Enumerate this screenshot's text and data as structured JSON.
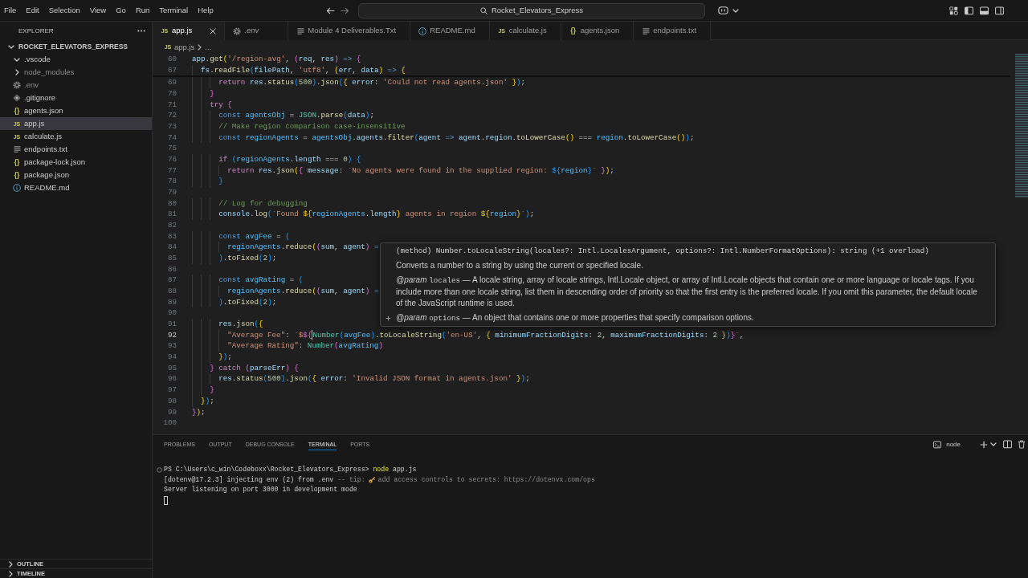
{
  "title_bar": {
    "menu": [
      "File",
      "Edit",
      "Selection",
      "View",
      "Go",
      "Run",
      "Terminal",
      "Help"
    ],
    "command_center": "Rocket_Elevators_Express"
  },
  "sidebar": {
    "title": "EXPLORER",
    "root": {
      "label": "ROCKET_ELEVATORS_EXPRESS",
      "expanded": true,
      "children": [
        {
          "label": ".vscode",
          "kind": "folder",
          "expanded": true,
          "selected": false,
          "ignored": false
        },
        {
          "label": "node_modules",
          "kind": "folder",
          "expanded": false,
          "selected": false,
          "ignored": true
        },
        {
          "label": ".env",
          "kind": "env",
          "selected": false,
          "ignored": true
        },
        {
          "label": ".gitignore",
          "kind": "gitignore",
          "selected": false,
          "ignored": false
        },
        {
          "label": "agents.json",
          "kind": "json",
          "glyph": "{}",
          "selected": false,
          "ignored": false
        },
        {
          "label": "app.js",
          "kind": "js",
          "glyph": "JS",
          "selected": true,
          "ignored": false
        },
        {
          "label": "calculate.js",
          "kind": "js",
          "glyph": "JS",
          "selected": false,
          "ignored": false
        },
        {
          "label": "endpoints.txt",
          "kind": "text",
          "selected": false,
          "ignored": false
        },
        {
          "label": "package-lock.json",
          "kind": "json",
          "glyph": "{}",
          "selected": false,
          "ignored": false
        },
        {
          "label": "package.json",
          "kind": "json",
          "glyph": "{}",
          "selected": false,
          "ignored": false
        },
        {
          "label": "README.md",
          "kind": "info",
          "selected": false,
          "ignored": false
        }
      ]
    },
    "sections": [
      {
        "label": "OUTLINE",
        "expanded": false
      },
      {
        "label": "TIMELINE",
        "expanded": false
      }
    ]
  },
  "tabs": [
    {
      "label": "app.js",
      "kind": "js",
      "glyph": "JS",
      "selected": true,
      "preview": false
    },
    {
      "label": ".env",
      "kind": "env",
      "selected": false,
      "preview": true
    },
    {
      "label": "Module 4 Deliverables.Txt",
      "kind": "text",
      "selected": false,
      "preview": false
    },
    {
      "label": "README.md",
      "kind": "info",
      "selected": false,
      "preview": false
    },
    {
      "label": "calculate.js",
      "kind": "js",
      "glyph": "JS",
      "selected": false,
      "preview": false
    },
    {
      "label": "agents.json",
      "kind": "json",
      "glyph": "{}",
      "selected": false,
      "preview": false
    },
    {
      "label": "endpoints.txt",
      "kind": "text",
      "selected": false,
      "preview": false
    }
  ],
  "breadcrumb": [
    {
      "label": "app.js",
      "kind": "js",
      "glyph": "JS"
    },
    {
      "label": "..."
    }
  ],
  "editor": {
    "sticky_lines": [
      {
        "number": "60",
        "tokens": [
          {
            "kind": "variable",
            "text": "app"
          },
          {
            "kind": "plain",
            "text": "."
          },
          {
            "kind": "function",
            "text": "get"
          },
          {
            "kind": "bracket1",
            "text": "("
          },
          {
            "kind": "string",
            "text": "'/region-avg'"
          },
          {
            "kind": "plain",
            "text": ", "
          },
          {
            "kind": "bracket2",
            "text": "("
          },
          {
            "kind": "variable",
            "text": "req"
          },
          {
            "kind": "plain",
            "text": ", "
          },
          {
            "kind": "variable",
            "text": "res"
          },
          {
            "kind": "bracket2",
            "text": ")"
          },
          {
            "kind": "keyword",
            "text": " => "
          },
          {
            "kind": "bracket2",
            "text": "{"
          }
        ]
      },
      {
        "number": "67",
        "tokens": [
          {
            "kind": "variable",
            "text": "  fs"
          },
          {
            "kind": "plain",
            "text": "."
          },
          {
            "kind": "function",
            "text": "readFile"
          },
          {
            "kind": "bracket3",
            "text": "("
          },
          {
            "kind": "variable",
            "text": "filePath"
          },
          {
            "kind": "plain",
            "text": ", "
          },
          {
            "kind": "string",
            "text": "'utf8'"
          },
          {
            "kind": "plain",
            "text": ", "
          },
          {
            "kind": "bracket1",
            "text": "("
          },
          {
            "kind": "variable",
            "text": "err"
          },
          {
            "kind": "plain",
            "text": ", "
          },
          {
            "kind": "variable",
            "text": "data"
          },
          {
            "kind": "bracket1",
            "text": ")"
          },
          {
            "kind": "keyword",
            "text": " => "
          },
          {
            "kind": "bracket1",
            "text": "{"
          }
        ]
      }
    ],
    "lines": [
      {
        "number": "69",
        "tokens": [
          {
            "kind": "control",
            "text": "      return "
          },
          {
            "kind": "variable",
            "text": "res"
          },
          {
            "kind": "plain",
            "text": "."
          },
          {
            "kind": "function",
            "text": "status"
          },
          {
            "kind": "bracket3",
            "text": "("
          },
          {
            "kind": "number",
            "text": "500"
          },
          {
            "kind": "bracket3",
            "text": ")"
          },
          {
            "kind": "plain",
            "text": "."
          },
          {
            "kind": "function",
            "text": "json"
          },
          {
            "kind": "bracket3",
            "text": "("
          },
          {
            "kind": "bracket1",
            "text": "{ "
          },
          {
            "kind": "variable",
            "text": "error"
          },
          {
            "kind": "plain",
            "text": ": "
          },
          {
            "kind": "string",
            "text": "'Could not read agents.json'"
          },
          {
            "kind": "bracket1",
            "text": " }"
          },
          {
            "kind": "bracket3",
            "text": ")"
          },
          {
            "kind": "plain",
            "text": ";"
          }
        ]
      },
      {
        "number": "70",
        "tokens": [
          {
            "kind": "bracket2",
            "text": "    }"
          }
        ]
      },
      {
        "number": "71",
        "tokens": [
          {
            "kind": "control",
            "text": "    try "
          },
          {
            "kind": "bracket2",
            "text": "{"
          }
        ]
      },
      {
        "number": "72",
        "tokens": [
          {
            "kind": "keyword",
            "text": "      const "
          },
          {
            "kind": "constant",
            "text": "agentsObj"
          },
          {
            "kind": "plain",
            "text": " = "
          },
          {
            "kind": "type",
            "text": "JSON"
          },
          {
            "kind": "plain",
            "text": "."
          },
          {
            "kind": "function",
            "text": "parse"
          },
          {
            "kind": "bracket3",
            "text": "("
          },
          {
            "kind": "variable",
            "text": "data"
          },
          {
            "kind": "bracket3",
            "text": ")"
          },
          {
            "kind": "plain",
            "text": ";"
          }
        ]
      },
      {
        "number": "73",
        "tokens": [
          {
            "kind": "comment",
            "text": "      // Make region comparison case-insensitive"
          }
        ]
      },
      {
        "number": "74",
        "tokens": [
          {
            "kind": "keyword",
            "text": "      const "
          },
          {
            "kind": "constant",
            "text": "regionAgents"
          },
          {
            "kind": "plain",
            "text": " = "
          },
          {
            "kind": "constant",
            "text": "agentsObj"
          },
          {
            "kind": "plain",
            "text": "."
          },
          {
            "kind": "variable",
            "text": "agents"
          },
          {
            "kind": "plain",
            "text": "."
          },
          {
            "kind": "function",
            "text": "filter"
          },
          {
            "kind": "bracket3",
            "text": "("
          },
          {
            "kind": "variable",
            "text": "agent"
          },
          {
            "kind": "keyword",
            "text": " => "
          },
          {
            "kind": "variable",
            "text": "agent"
          },
          {
            "kind": "plain",
            "text": "."
          },
          {
            "kind": "variable",
            "text": "region"
          },
          {
            "kind": "plain",
            "text": "."
          },
          {
            "kind": "function",
            "text": "toLowerCase"
          },
          {
            "kind": "bracket1",
            "text": "()"
          },
          {
            "kind": "plain",
            "text": " === "
          },
          {
            "kind": "constant",
            "text": "region"
          },
          {
            "kind": "plain",
            "text": "."
          },
          {
            "kind": "function",
            "text": "toLowerCase"
          },
          {
            "kind": "bracket1",
            "text": "()"
          },
          {
            "kind": "bracket3",
            "text": ")"
          },
          {
            "kind": "plain",
            "text": ";"
          }
        ]
      },
      {
        "number": "75"
      },
      {
        "number": "76",
        "tokens": [
          {
            "kind": "control",
            "text": "      if "
          },
          {
            "kind": "bracket3",
            "text": "("
          },
          {
            "kind": "constant",
            "text": "regionAgents"
          },
          {
            "kind": "plain",
            "text": "."
          },
          {
            "kind": "variable",
            "text": "length"
          },
          {
            "kind": "plain",
            "text": " === "
          },
          {
            "kind": "number",
            "text": "0"
          },
          {
            "kind": "bracket3",
            "text": ") {"
          }
        ]
      },
      {
        "number": "77",
        "tokens": [
          {
            "kind": "control",
            "text": "        return "
          },
          {
            "kind": "variable",
            "text": "res"
          },
          {
            "kind": "plain",
            "text": "."
          },
          {
            "kind": "function",
            "text": "json"
          },
          {
            "kind": "bracket1",
            "text": "("
          },
          {
            "kind": "bracket2",
            "text": "{ "
          },
          {
            "kind": "variable",
            "text": "message"
          },
          {
            "kind": "plain",
            "text": ": "
          },
          {
            "kind": "string",
            "text": "`No agents were found in the supplied region: "
          },
          {
            "kind": "bracket3",
            "text": "${"
          },
          {
            "kind": "constant",
            "text": "region"
          },
          {
            "kind": "bracket3",
            "text": "}"
          },
          {
            "kind": "string",
            "text": "`"
          },
          {
            "kind": "bracket2",
            "text": " }"
          },
          {
            "kind": "bracket1",
            "text": ")"
          },
          {
            "kind": "plain",
            "text": ";"
          }
        ]
      },
      {
        "number": "78",
        "tokens": [
          {
            "kind": "bracket3",
            "text": "      }"
          }
        ]
      },
      {
        "number": "79"
      },
      {
        "number": "80",
        "tokens": [
          {
            "kind": "comment",
            "text": "      // Log for debugging"
          }
        ]
      },
      {
        "number": "81",
        "tokens": [
          {
            "kind": "variable",
            "text": "      console"
          },
          {
            "kind": "plain",
            "text": "."
          },
          {
            "kind": "function",
            "text": "log"
          },
          {
            "kind": "bracket3",
            "text": "("
          },
          {
            "kind": "string",
            "text": "`Found "
          },
          {
            "kind": "bracket1",
            "text": "${"
          },
          {
            "kind": "constant",
            "text": "regionAgents"
          },
          {
            "kind": "plain",
            "text": "."
          },
          {
            "kind": "variable",
            "text": "length"
          },
          {
            "kind": "bracket1",
            "text": "}"
          },
          {
            "kind": "string",
            "text": " agents in region "
          },
          {
            "kind": "bracket1",
            "text": "${"
          },
          {
            "kind": "constant",
            "text": "region"
          },
          {
            "kind": "bracket1",
            "text": "}"
          },
          {
            "kind": "string",
            "text": "`"
          },
          {
            "kind": "bracket3",
            "text": ")"
          },
          {
            "kind": "plain",
            "text": ";"
          }
        ]
      },
      {
        "number": "82"
      },
      {
        "number": "83",
        "tokens": [
          {
            "kind": "keyword",
            "text": "      const "
          },
          {
            "kind": "constant",
            "text": "avgFee"
          },
          {
            "kind": "plain",
            "text": " = "
          },
          {
            "kind": "bracket3",
            "text": "("
          }
        ]
      },
      {
        "number": "84",
        "tokens": [
          {
            "kind": "constant",
            "text": "        regionAgents"
          },
          {
            "kind": "plain",
            "text": "."
          },
          {
            "kind": "function",
            "text": "reduce"
          },
          {
            "kind": "bracket1",
            "text": "("
          },
          {
            "kind": "bracket2",
            "text": "("
          },
          {
            "kind": "variable",
            "text": "sum"
          },
          {
            "kind": "plain",
            "text": ", "
          },
          {
            "kind": "variable",
            "text": "agent"
          },
          {
            "kind": "bracket2",
            "text": ")"
          },
          {
            "kind": "keyword",
            "text": " ="
          }
        ]
      },
      {
        "number": "85",
        "tokens": [
          {
            "kind": "bracket3",
            "text": "      )"
          },
          {
            "kind": "plain",
            "text": "."
          },
          {
            "kind": "function",
            "text": "toFixed"
          },
          {
            "kind": "bracket3",
            "text": "("
          },
          {
            "kind": "number",
            "text": "2"
          },
          {
            "kind": "bracket3",
            "text": ")"
          },
          {
            "kind": "plain",
            "text": ";"
          }
        ]
      },
      {
        "number": "86"
      },
      {
        "number": "87",
        "tokens": [
          {
            "kind": "keyword",
            "text": "      const "
          },
          {
            "kind": "constant",
            "text": "avgRating"
          },
          {
            "kind": "plain",
            "text": " = "
          },
          {
            "kind": "bracket3",
            "text": "("
          }
        ]
      },
      {
        "number": "88",
        "tokens": [
          {
            "kind": "constant",
            "text": "        regionAgents"
          },
          {
            "kind": "plain",
            "text": "."
          },
          {
            "kind": "function",
            "text": "reduce"
          },
          {
            "kind": "bracket1",
            "text": "("
          },
          {
            "kind": "bracket2",
            "text": "("
          },
          {
            "kind": "variable",
            "text": "sum"
          },
          {
            "kind": "plain",
            "text": ", "
          },
          {
            "kind": "variable",
            "text": "agent"
          },
          {
            "kind": "bracket2",
            "text": ")"
          },
          {
            "kind": "keyword",
            "text": " ="
          }
        ]
      },
      {
        "number": "89",
        "tokens": [
          {
            "kind": "bracket3",
            "text": "      )"
          },
          {
            "kind": "plain",
            "text": "."
          },
          {
            "kind": "function",
            "text": "toFixed"
          },
          {
            "kind": "bracket3",
            "text": "("
          },
          {
            "kind": "number",
            "text": "2"
          },
          {
            "kind": "bracket3",
            "text": ")"
          },
          {
            "kind": "plain",
            "text": ";"
          }
        ]
      },
      {
        "number": "90"
      },
      {
        "number": "91",
        "tokens": [
          {
            "kind": "variable",
            "text": "      res"
          },
          {
            "kind": "plain",
            "text": "."
          },
          {
            "kind": "function",
            "text": "json"
          },
          {
            "kind": "bracket3",
            "text": "("
          },
          {
            "kind": "bracket1",
            "text": "{"
          }
        ]
      },
      {
        "number": "92",
        "tokens": [
          {
            "kind": "string",
            "text": "        \"Average Fee\""
          },
          {
            "kind": "plain",
            "text": ": "
          },
          {
            "kind": "string",
            "text": "`$"
          },
          {
            "kind": "bracket2",
            "text": "${"
          },
          {
            "kind": "caret"
          },
          {
            "kind": "type",
            "text": "Number"
          },
          {
            "kind": "bracket3",
            "text": "("
          },
          {
            "kind": "constant",
            "text": "avgFee"
          },
          {
            "kind": "bracket3",
            "text": ")"
          },
          {
            "kind": "plain",
            "text": "."
          },
          {
            "kind": "function",
            "text": "toLocaleString"
          },
          {
            "kind": "bracket3",
            "text": "("
          },
          {
            "kind": "string",
            "text": "'en-US'"
          },
          {
            "kind": "plain",
            "text": ", "
          },
          {
            "kind": "bracket1",
            "text": "{ "
          },
          {
            "kind": "variable",
            "text": "minimumFractionDigits"
          },
          {
            "kind": "plain",
            "text": ": "
          },
          {
            "kind": "number",
            "text": "2"
          },
          {
            "kind": "plain",
            "text": ", "
          },
          {
            "kind": "variable",
            "text": "maximumFractionDigits"
          },
          {
            "kind": "plain",
            "text": ": "
          },
          {
            "kind": "number",
            "text": "2"
          },
          {
            "kind": "bracket1",
            "text": " }"
          },
          {
            "kind": "bracket3",
            "text": ")"
          },
          {
            "kind": "bracket2",
            "text": "}"
          },
          {
            "kind": "string",
            "text": "`"
          },
          {
            "kind": "plain",
            "text": ","
          }
        ]
      },
      {
        "number": "93",
        "tokens": [
          {
            "kind": "string",
            "text": "        \"Average Rating\""
          },
          {
            "kind": "plain",
            "text": ": "
          },
          {
            "kind": "type",
            "text": "Number"
          },
          {
            "kind": "bracket2",
            "text": "("
          },
          {
            "kind": "constant",
            "text": "avgRating"
          },
          {
            "kind": "bracket2",
            "text": ")"
          }
        ]
      },
      {
        "number": "94",
        "tokens": [
          {
            "kind": "bracket1",
            "text": "      }"
          },
          {
            "kind": "bracket3",
            "text": ")"
          },
          {
            "kind": "plain",
            "text": ";"
          }
        ]
      },
      {
        "number": "95",
        "tokens": [
          {
            "kind": "bracket2",
            "text": "    } "
          },
          {
            "kind": "control",
            "text": "catch "
          },
          {
            "kind": "bracket2",
            "text": "("
          },
          {
            "kind": "variable",
            "text": "parseErr"
          },
          {
            "kind": "bracket2",
            "text": ") {"
          }
        ]
      },
      {
        "number": "96",
        "tokens": [
          {
            "kind": "variable",
            "text": "      res"
          },
          {
            "kind": "plain",
            "text": "."
          },
          {
            "kind": "function",
            "text": "status"
          },
          {
            "kind": "bracket3",
            "text": "("
          },
          {
            "kind": "number",
            "text": "500"
          },
          {
            "kind": "bracket3",
            "text": ")"
          },
          {
            "kind": "plain",
            "text": "."
          },
          {
            "kind": "function",
            "text": "json"
          },
          {
            "kind": "bracket3",
            "text": "("
          },
          {
            "kind": "bracket1",
            "text": "{ "
          },
          {
            "kind": "variable",
            "text": "error"
          },
          {
            "kind": "plain",
            "text": ": "
          },
          {
            "kind": "string",
            "text": "'Invalid JSON format in agents.json'"
          },
          {
            "kind": "bracket1",
            "text": " }"
          },
          {
            "kind": "bracket3",
            "text": ")"
          },
          {
            "kind": "plain",
            "text": ";"
          }
        ]
      },
      {
        "number": "97",
        "tokens": [
          {
            "kind": "bracket2",
            "text": "    }"
          }
        ]
      },
      {
        "number": "98",
        "tokens": [
          {
            "kind": "bracket1",
            "text": "  }"
          },
          {
            "kind": "bracket3",
            "text": ")"
          },
          {
            "kind": "plain",
            "text": ";"
          }
        ]
      },
      {
        "number": "99",
        "tokens": [
          {
            "kind": "bracket2",
            "text": "}"
          },
          {
            "kind": "bracket1",
            "text": ")"
          },
          {
            "kind": "plain",
            "text": ";"
          }
        ]
      },
      {
        "number": "100"
      }
    ],
    "hover": {
      "signature": "(method) Number.toLocaleString(locales?: Intl.LocalesArgument, options?: Intl.NumberFormatOptions): string (+1 overload)",
      "summary": "Converts a number to a string by using the current or specified locale.",
      "params": [
        {
          "tag": "@param",
          "name": "locales",
          "description": "— A locale string, array of locale strings, Intl.Locale object, or array of Intl.Locale objects that contain one or more language or locale tags. If you include more than one locale string, list them in descending order of priority so that the first entry is the preferred locale. If you omit this parameter, the default locale of the JavaScript runtime is used."
        },
        {
          "tag": "@param",
          "name": "options",
          "description": "— An object that contains one or more properties that specify comparison options."
        }
      ]
    }
  },
  "panel": {
    "tabs": [
      {
        "label": "PROBLEMS",
        "selected": false
      },
      {
        "label": "OUTPUT",
        "selected": false
      },
      {
        "label": "DEBUG CONSOLE",
        "selected": false
      },
      {
        "label": "TERMINAL",
        "selected": true
      },
      {
        "label": "PORTS",
        "selected": false
      }
    ],
    "terminal_name": "node",
    "terminal_lines": [
      {
        "decorated": true,
        "segments": [
          {
            "kind": "prompt",
            "text": "PS C:\\Users\\c_win\\Codeboxx\\Rocket_Elevators_Express> "
          },
          {
            "kind": "command",
            "text": "node"
          },
          {
            "kind": "output",
            "text": " app.js"
          }
        ]
      },
      {
        "decorated": false,
        "segments": [
          {
            "kind": "output",
            "text": "[dotenv@17.2.3] injecting env (2) from .env"
          },
          {
            "kind": "hint",
            "text": " -- tip:"
          },
          {
            "kind": "key_icon"
          },
          {
            "kind": "hint",
            "text": "add access controls to secrets: https://dotenvx.com/ops"
          }
        ]
      },
      {
        "decorated": false,
        "segments": [
          {
            "kind": "output",
            "text": "Server listening on port 3000 in development mode"
          }
        ]
      },
      {
        "decorated": false,
        "segments": [
          {
            "kind": "cursor"
          }
        ]
      }
    ]
  }
}
